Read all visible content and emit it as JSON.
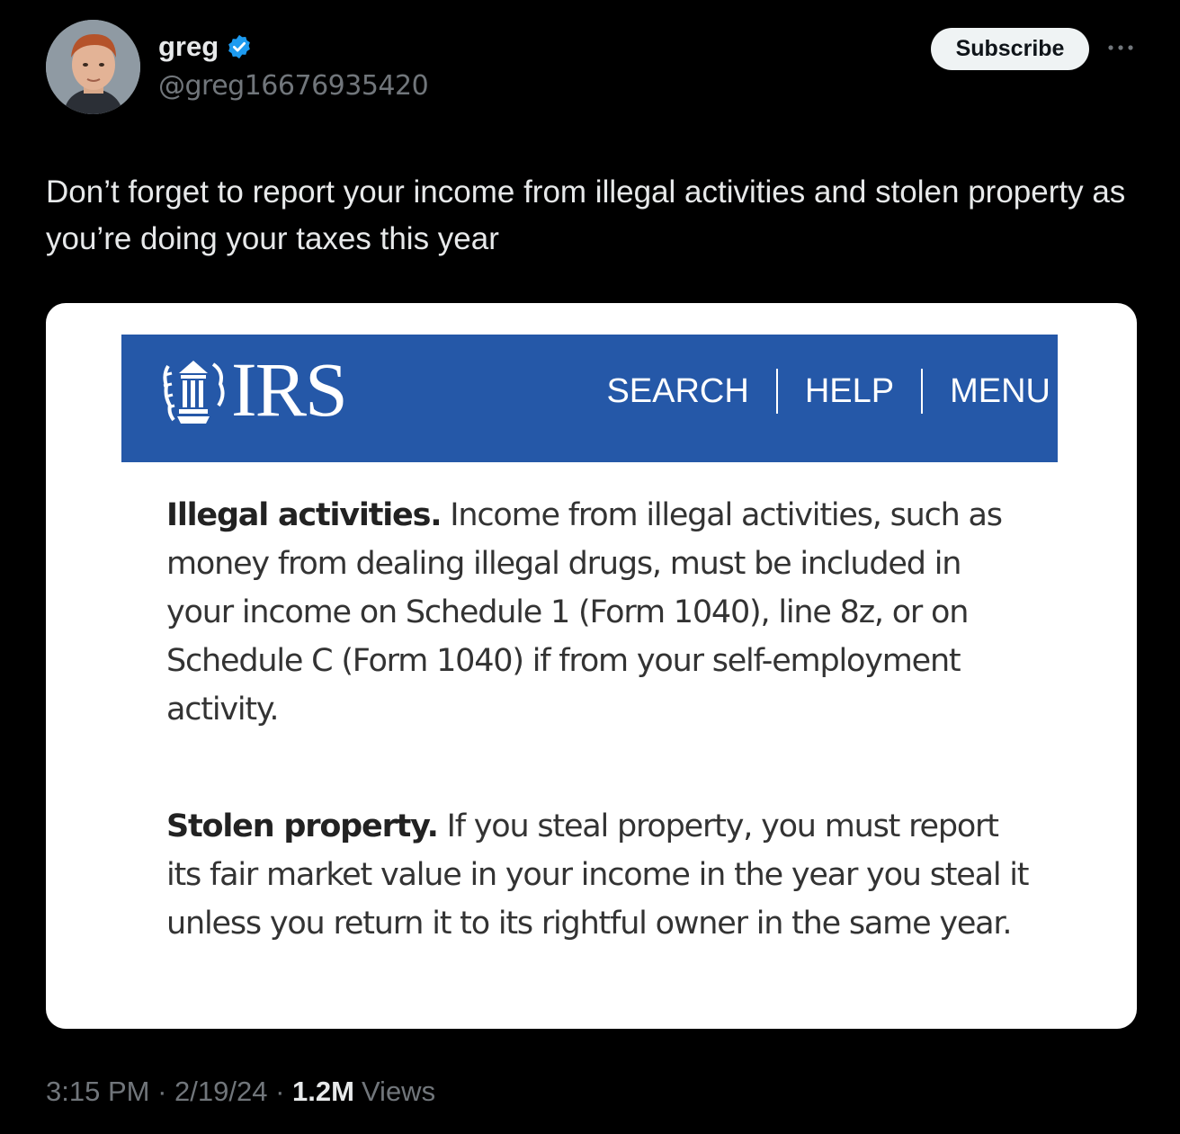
{
  "author": {
    "name": "greg",
    "handle": "@greg16676935420",
    "verified_icon": "verified-badge-icon"
  },
  "actions": {
    "subscribe_label": "Subscribe",
    "more_icon": "more-options-icon"
  },
  "tweet": {
    "text": "Don’t forget to report your income from illegal activities and stolen property as you’re doing your taxes this year"
  },
  "image": {
    "header": {
      "logo_text": "IRS",
      "nav": [
        "SEARCH",
        "HELP",
        "MENU"
      ],
      "color": "#2558a8"
    },
    "paragraphs": [
      {
        "title": "Illegal activities.",
        "body": " Income from illegal activities, such as money from dealing illegal drugs, must be included in your income on Schedule 1 (Form 1040), line 8z, or on Schedule C (Form 1040) if from your self-employment activity."
      },
      {
        "title": "Stolen property.",
        "body": " If you steal property, you must report its fair market value in your income in the year you steal it unless you return it to its rightful owner in the same year."
      }
    ]
  },
  "meta": {
    "time": "3:15 PM",
    "sep1": " · ",
    "date": "2/19/24",
    "sep2": " · ",
    "views_count": "1.2M",
    "views_label": "Views"
  },
  "colors": {
    "background": "#000000",
    "verified": "#1d9bf0",
    "muted": "#71767b"
  }
}
